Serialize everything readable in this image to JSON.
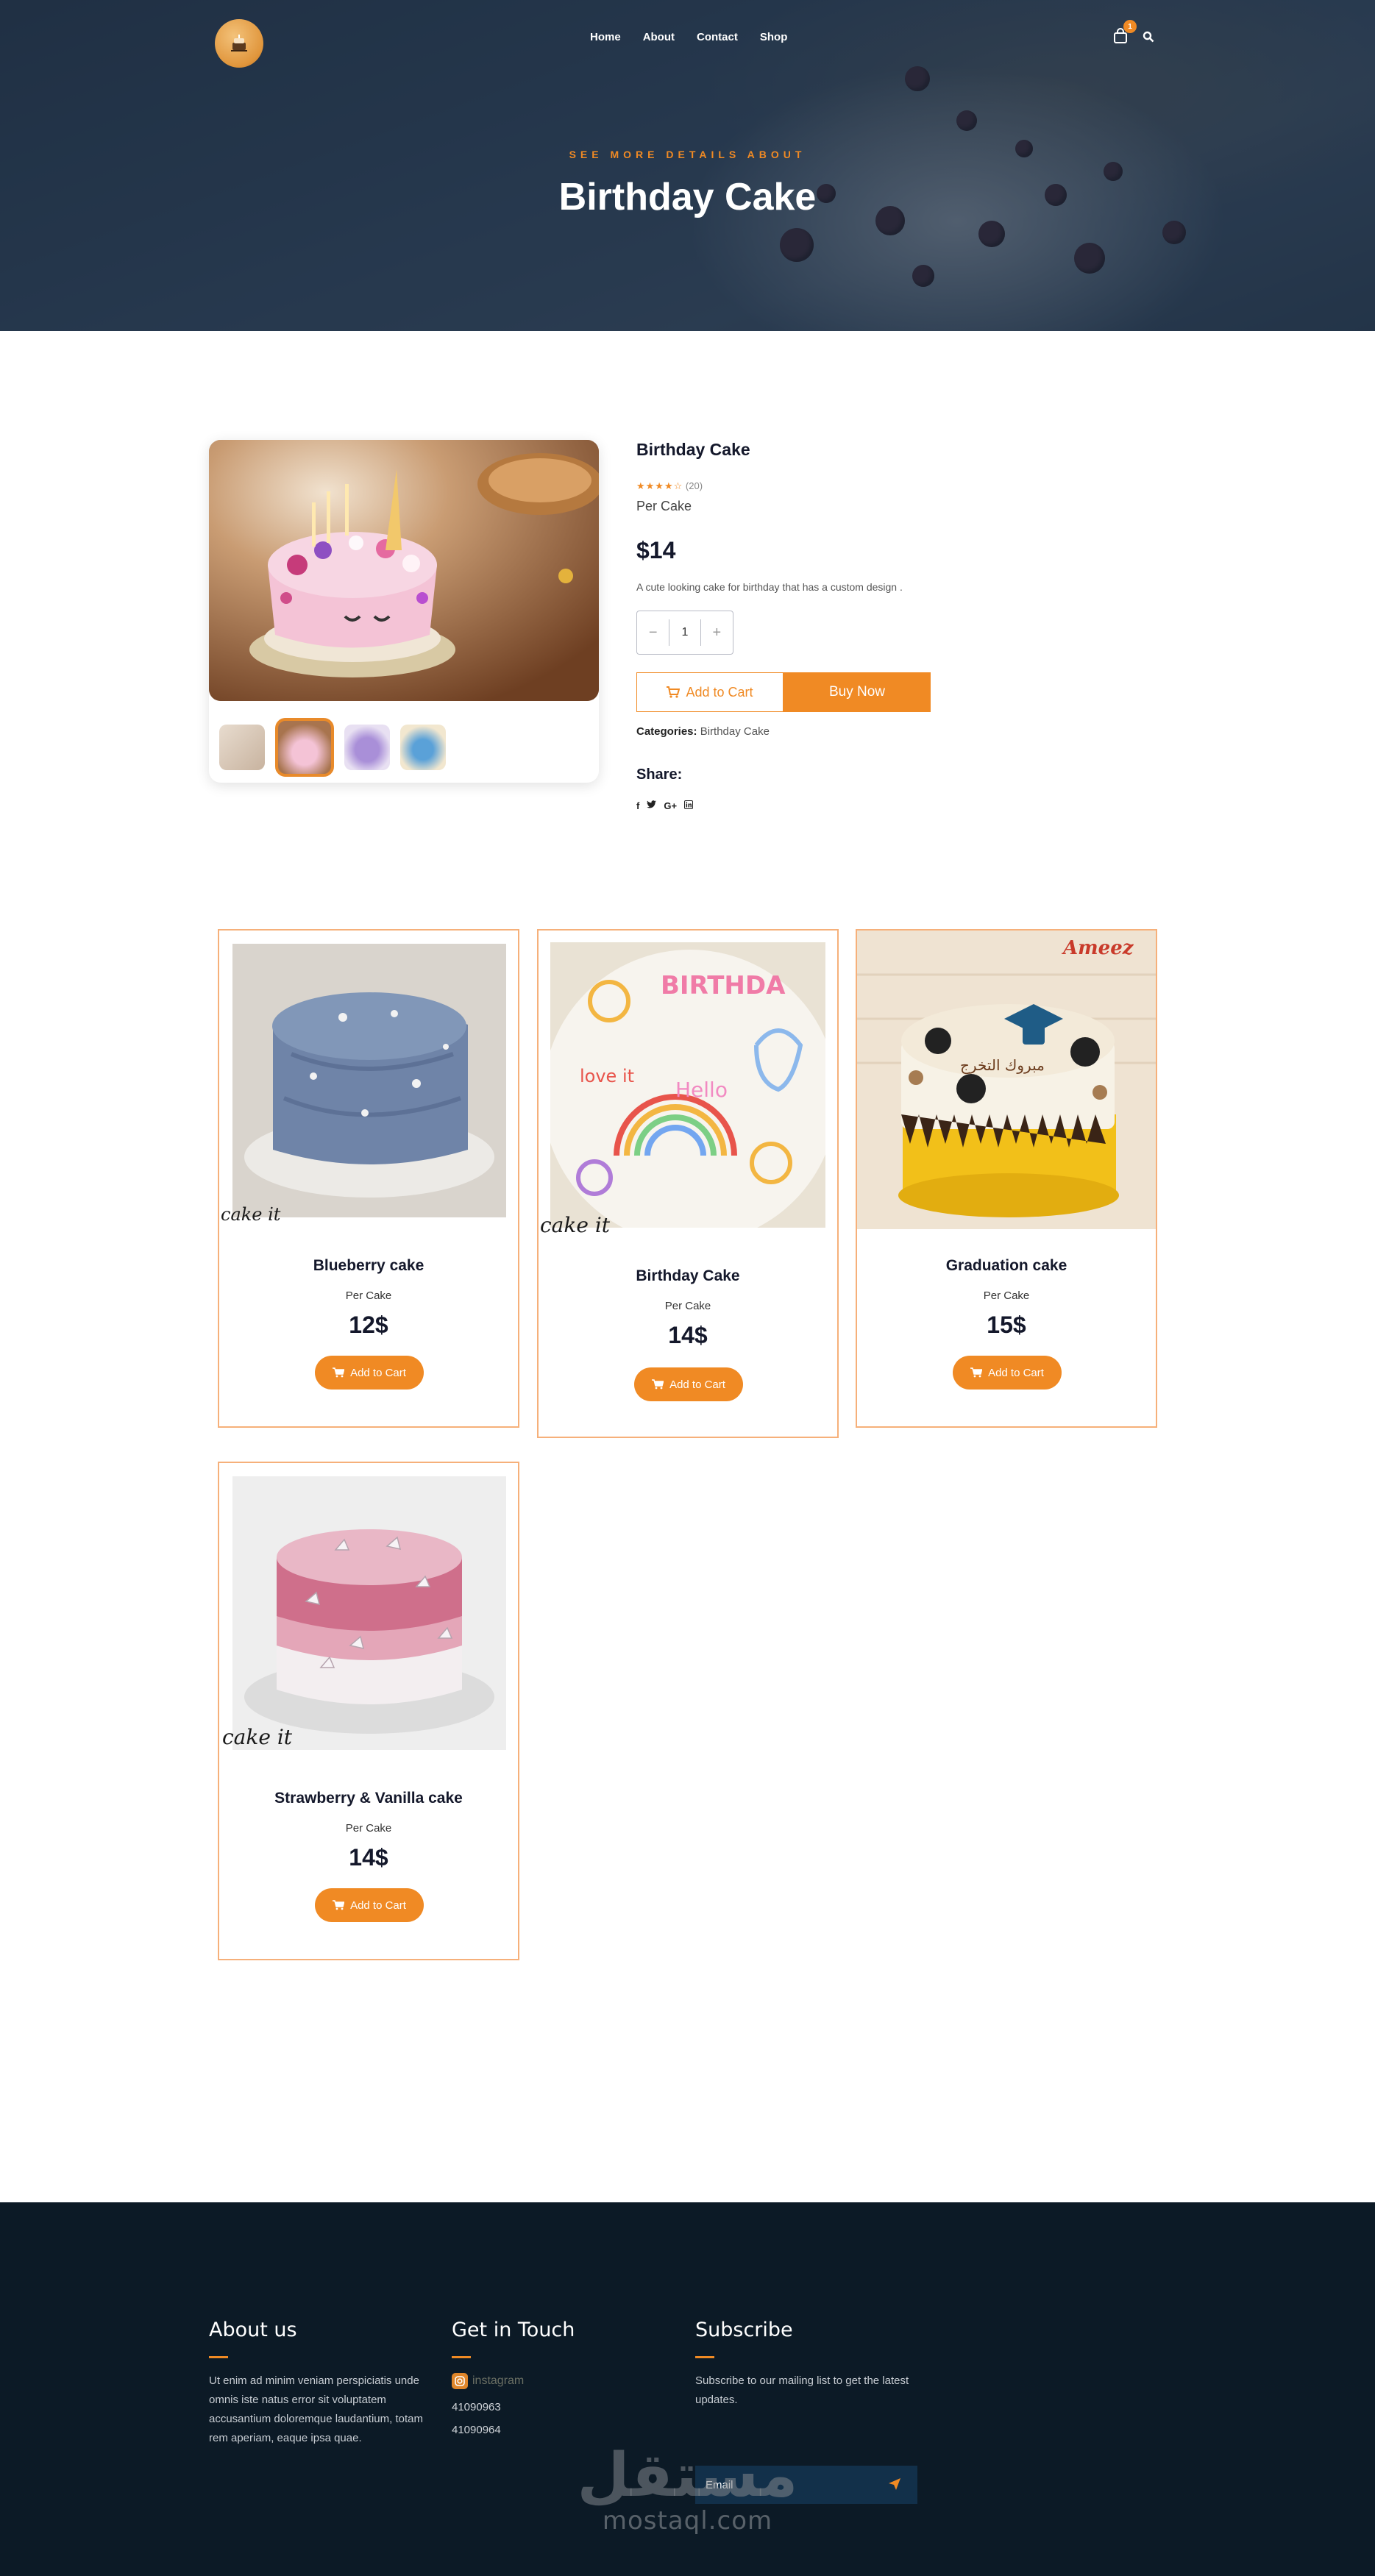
{
  "header": {
    "nav": [
      "Home",
      "About",
      "Contact",
      "Shop"
    ],
    "cart_count": "1",
    "icons": {
      "logo": "cake-logo-icon",
      "cart": "shopping-bag-icon",
      "search": "search-icon"
    }
  },
  "hero": {
    "kicker": "SEE MORE DETAILS ABOUT",
    "title": "Birthday Cake"
  },
  "product": {
    "name": "Birthday Cake",
    "stars": "★★★★☆",
    "rating_count": "(20)",
    "unit": "Per Cake",
    "price": "$14",
    "description": "A cute looking cake for birthday that has a custom design .",
    "quantity": "1",
    "qty_minus": "−",
    "qty_plus": "+",
    "add_to_cart": "Add to Cart",
    "buy_now": "Buy Now",
    "categories_label": "Categories:",
    "categories_value": "Birthday Cake",
    "share_label": "Share:",
    "share_icons": [
      "f",
      "t",
      "G+",
      "in"
    ]
  },
  "related": [
    {
      "name": "Blueberry cake",
      "unit": "Per Cake",
      "price": "12$",
      "cta": "Add to Cart",
      "brand": "cake it"
    },
    {
      "name": "Birthday Cake",
      "unit": "Per Cake",
      "price": "14$",
      "cta": "Add to Cart",
      "brand": "cake it"
    },
    {
      "name": "Graduation cake",
      "unit": "Per Cake",
      "price": "15$",
      "cta": "Add to Cart",
      "brand": "Ameez"
    },
    {
      "name": "Strawberry & Vanilla cake",
      "unit": "Per Cake",
      "price": "14$",
      "cta": "Add to Cart",
      "brand": "cake it"
    }
  ],
  "footer": {
    "about_title": "About us",
    "about_text": "Ut enim ad minim veniam perspiciatis unde omnis iste natus error sit voluptatem accusantium doloremque laudantium, totam rem aperiam, eaque ipsa quae.",
    "contact_title": "Get in Touch",
    "instagram": "instagram",
    "phone1": "41090963",
    "phone2": "41090964",
    "subscribe_title": "Subscribe",
    "subscribe_text": "Subscribe to our mailing list to get the latest updates.",
    "email_placeholder": "Email"
  },
  "watermark": {
    "arabic": "مستقل",
    "latin": "mostaql.com"
  },
  "colors": {
    "accent": "#f08a24",
    "dark": "#0c1a26",
    "card_border": "#f6b07a"
  }
}
